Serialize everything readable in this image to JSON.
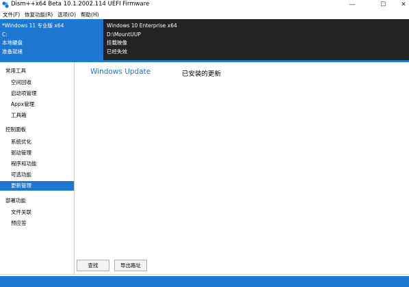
{
  "window": {
    "title": "Dism++x64 Beta 10.1.2002.114 UEFI Firmware",
    "controls": {
      "minimize": "—",
      "maximize": "☐",
      "close": "✕"
    }
  },
  "menu": [
    {
      "label": "文件(F)"
    },
    {
      "label": "恢复功能(R)"
    },
    {
      "label": "选项(O)"
    },
    {
      "label": "帮助(H)"
    }
  ],
  "images": {
    "left": {
      "name": "*Windows 11 专业版 x64",
      "path": "C:",
      "type": "本地硬盘",
      "status": "准备就绪"
    },
    "right": {
      "name": "Windows 10 Enterprise x64",
      "path": "D:\\MountUUP",
      "type": "挂载映像",
      "status": "已经失效"
    }
  },
  "sidebar": {
    "groups": [
      {
        "label": "常用工具",
        "items": [
          {
            "label": "空间回收"
          },
          {
            "label": "启动项管理"
          },
          {
            "label": "Appx管理"
          },
          {
            "label": "工具箱"
          }
        ]
      },
      {
        "label": "控制面板",
        "items": [
          {
            "label": "系统优化"
          },
          {
            "label": "驱动管理"
          },
          {
            "label": "程序和功能"
          },
          {
            "label": "可选功能"
          },
          {
            "label": "更新管理",
            "active": true
          }
        ]
      },
      {
        "label": "部署功能",
        "items": [
          {
            "label": "文件关联"
          },
          {
            "label": "预应答"
          }
        ]
      }
    ]
  },
  "main": {
    "tabs": [
      {
        "label": "Windows Update",
        "active": true
      },
      {
        "label": "已安装的更新"
      }
    ],
    "buttons": {
      "search": "查找",
      "export": "导出路址"
    }
  },
  "colors": {
    "accent": "#1e78d2",
    "dark_panel": "#232323"
  }
}
